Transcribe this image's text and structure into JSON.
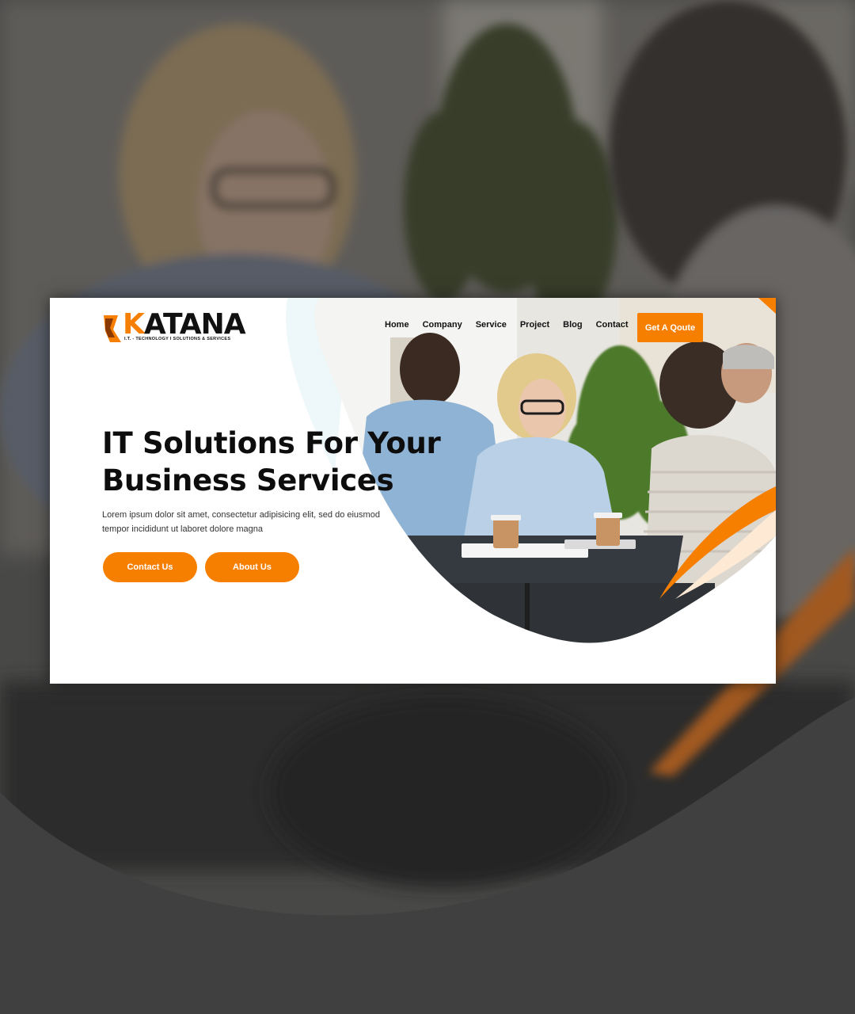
{
  "brand": {
    "logo_word_lead": "K",
    "logo_word_rest": "ATANA",
    "logo_tagline": "I.T. - TECHNOLOGY I SOLUTIONS & SERVICES"
  },
  "nav": {
    "items": [
      {
        "label": "Home"
      },
      {
        "label": "Company"
      },
      {
        "label": "Service"
      },
      {
        "label": "Project"
      },
      {
        "label": "Blog"
      },
      {
        "label": "Contact"
      }
    ],
    "cta_label": "Get A Qoute"
  },
  "hero": {
    "title_line1": "IT Solutions For Your",
    "title_line2": "Business Services",
    "description": "Lorem ipsum dolor sit amet, consectetur adipisicing elit, sed do eiusmod tempor incididunt ut laboret dolore magna",
    "contact_label": "Contact Us",
    "about_label": "About Us"
  },
  "colors": {
    "accent": "#f77f00",
    "background": "#4b4b4b",
    "text": "#0d0d0d"
  }
}
